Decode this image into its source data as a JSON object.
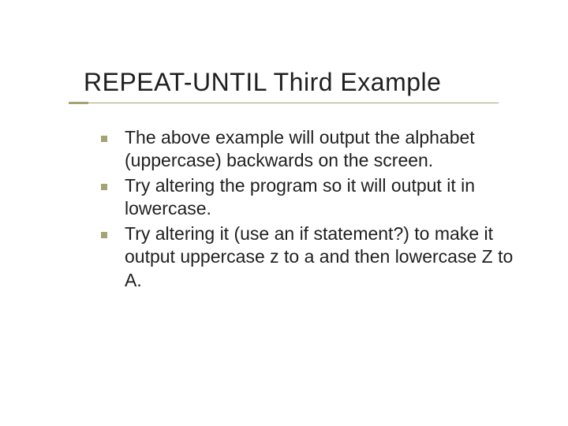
{
  "slide": {
    "title": "REPEAT-UNTIL Third Example",
    "bullets": [
      "The above example will output the alphabet (uppercase) backwards on the screen.",
      "Try altering the program so it will output it in lowercase.",
      "Try altering it (use an if statement?) to make it output uppercase z to a and then lowercase Z to A."
    ]
  }
}
